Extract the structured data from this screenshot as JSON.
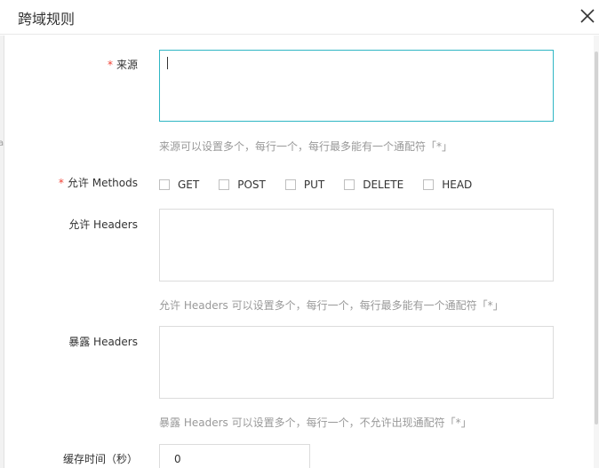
{
  "dialog": {
    "title": "跨域规则"
  },
  "form": {
    "origin": {
      "required_mark": "*",
      "label": "来源",
      "value": "",
      "help": "来源可以设置多个，每行一个，每行最多能有一个通配符「*」"
    },
    "methods": {
      "required_mark": "*",
      "label": "允许 Methods",
      "options": [
        {
          "label": "GET",
          "checked": false
        },
        {
          "label": "POST",
          "checked": false
        },
        {
          "label": "PUT",
          "checked": false
        },
        {
          "label": "DELETE",
          "checked": false
        },
        {
          "label": "HEAD",
          "checked": false
        }
      ]
    },
    "allow_headers": {
      "label": "允许 Headers",
      "value": "",
      "help": "允许 Headers 可以设置多个，每行一个，每行最多能有一个通配符「*」"
    },
    "expose_headers": {
      "label": "暴露 Headers",
      "value": "",
      "help": "暴露 Headers 可以设置多个，每行一个，不允许出现通配符「*」"
    },
    "cache_time": {
      "label": "缓存时间（秒）",
      "value": "0"
    }
  },
  "background_fragments": [
    "a"
  ],
  "colors": {
    "focus_border": "#2fb6c4",
    "required": "#f04134",
    "help_text": "#999999"
  }
}
